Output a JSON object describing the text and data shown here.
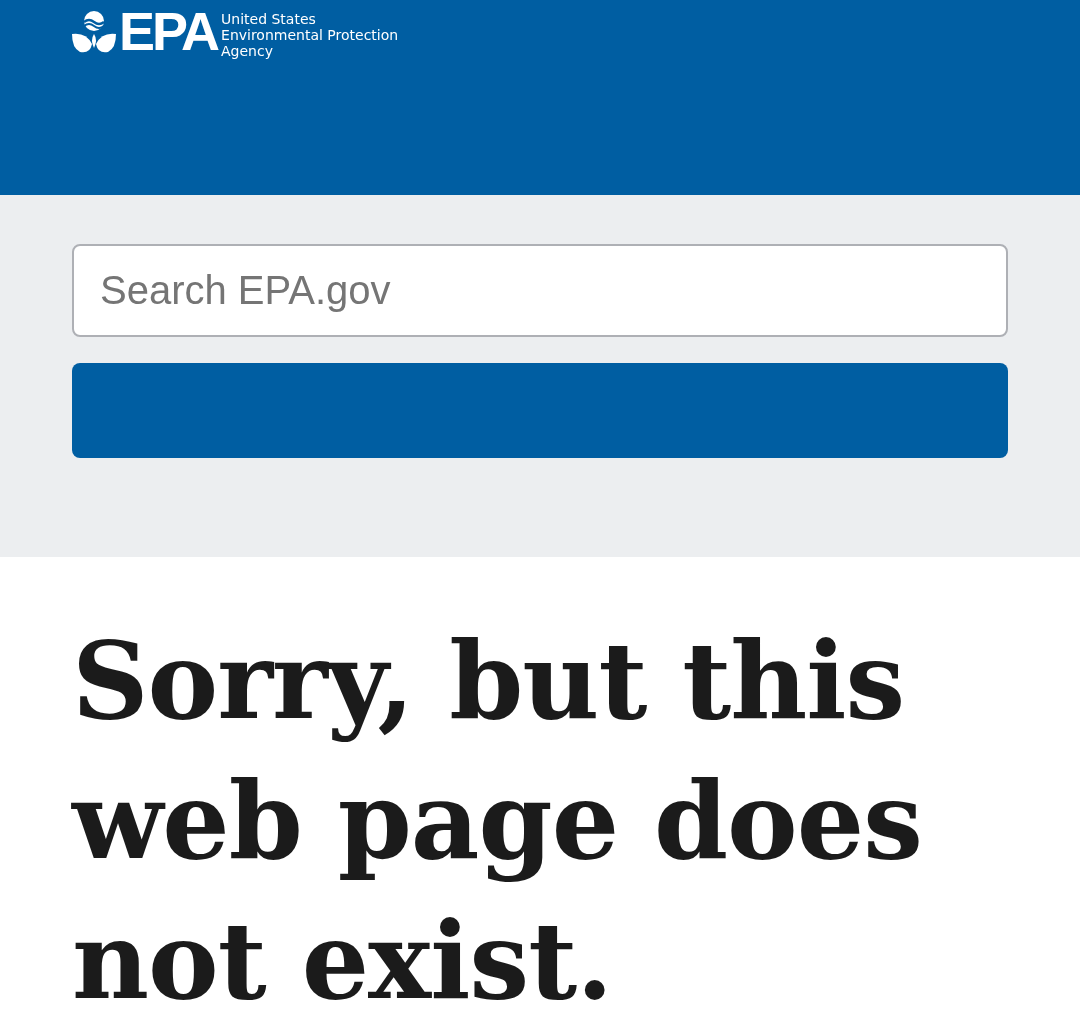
{
  "header": {
    "logo": {
      "wordmark": "EPA",
      "agency_name": [
        "United States",
        "Environmental Protection",
        "Agency"
      ]
    }
  },
  "search": {
    "placeholder": "Search EPA.gov"
  },
  "heading": "Sorry, but this web page does not exist."
}
